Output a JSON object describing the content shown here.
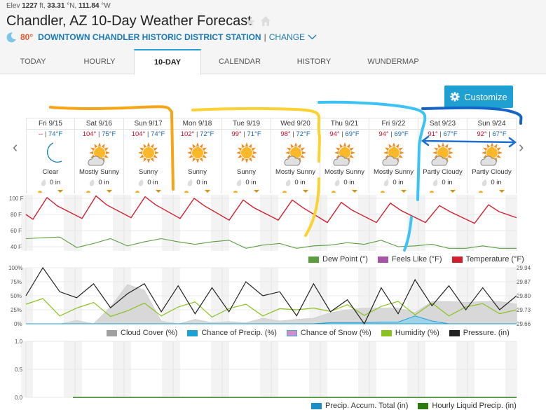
{
  "header": {
    "elevation_label": "Elev",
    "elevation_value": "1227",
    "elevation_unit": "ft,",
    "lat": "33.31",
    "lat_unit": "°N,",
    "lon": "111.84",
    "lon_unit": "°W",
    "title": "Chandler, AZ 10-Day Weather Forecast",
    "current_temp": "80°",
    "station_name": "DOWNTOWN CHANDLER HISTORIC DISTRICT STATION",
    "separator": "|",
    "change_label": "CHANGE"
  },
  "tabs": [
    {
      "label": "TODAY",
      "active": false
    },
    {
      "label": "HOURLY",
      "active": false
    },
    {
      "label": "10-DAY",
      "active": true
    },
    {
      "label": "CALENDAR",
      "active": false
    },
    {
      "label": "HISTORY",
      "active": false
    },
    {
      "label": "WUNDERMAP",
      "active": false
    }
  ],
  "customize_label": "Customize",
  "days": [
    {
      "name": "Fri 9/15",
      "hi": "--",
      "lo": "74°F",
      "icon": "moon-icon",
      "cond": "Clear",
      "precip": "0 in"
    },
    {
      "name": "Sat 9/16",
      "hi": "104°",
      "lo": "75°F",
      "icon": "mostly-sunny-icon",
      "cond": "Mostly Sunny",
      "precip": "0 in"
    },
    {
      "name": "Sun 9/17",
      "hi": "104°",
      "lo": "74°F",
      "icon": "sunny-icon",
      "cond": "Sunny",
      "precip": "0 in"
    },
    {
      "name": "Mon 9/18",
      "hi": "102°",
      "lo": "72°F",
      "icon": "sunny-icon",
      "cond": "Sunny",
      "precip": "0 in"
    },
    {
      "name": "Tue 9/19",
      "hi": "99°",
      "lo": "71°F",
      "icon": "sunny-icon",
      "cond": "Sunny",
      "precip": "0 in"
    },
    {
      "name": "Wed 9/20",
      "hi": "98°",
      "lo": "72°F",
      "icon": "mostly-sunny-icon",
      "cond": "Mostly Sunny",
      "precip": "0 in"
    },
    {
      "name": "Thu 9/21",
      "hi": "94°",
      "lo": "69°F",
      "icon": "mostly-sunny-icon",
      "cond": "Mostly Sunny",
      "precip": "0 in"
    },
    {
      "name": "Fri 9/22",
      "hi": "94°",
      "lo": "69°F",
      "icon": "mostly-sunny-icon",
      "cond": "Mostly Sunny",
      "precip": "0 in"
    },
    {
      "name": "Sat 9/23",
      "hi": "91°",
      "lo": "67°F",
      "icon": "partly-cloudy-icon",
      "cond": "Partly Cloudy",
      "precip": "0 in"
    },
    {
      "name": "Sun 9/24",
      "hi": "92°",
      "lo": "67°F",
      "icon": "partly-cloudy-icon",
      "cond": "Partly Cloudy",
      "precip": "0 in"
    }
  ],
  "colors": {
    "accent": "#1ea0d3",
    "temperature": "#d0202e",
    "dew_point": "#5a9e3e",
    "feels_like": "#a855a8",
    "cloud_cover": "#a0a0a0",
    "precip_chance": "#1ea0d3",
    "snow_chance": "#d08ec8",
    "humidity": "#8cc21e",
    "pressure": "#222222",
    "precip_accum": "#1a8fc4",
    "hourly_precip": "#2a7a10"
  },
  "chart_data": [
    {
      "type": "line",
      "title": "Temperature",
      "x": [
        "Fri 9/15",
        "Sat 9/16",
        "Sun 9/17",
        "Mon 9/18",
        "Tue 9/19",
        "Wed 9/20",
        "Thu 9/21",
        "Fri 9/22",
        "Sat 9/23",
        "Sun 9/24"
      ],
      "yticks": [
        "100 F",
        "80 F",
        "60 F",
        "40 F"
      ],
      "ylim": [
        37,
        102
      ],
      "series": [
        {
          "name": "Temperature (°F)",
          "daily_max": [
            101,
            103,
            102,
            100,
            98,
            98,
            95,
            94,
            91,
            92
          ],
          "daily_min": [
            74,
            75,
            76,
            75,
            73,
            73,
            70,
            70,
            70,
            69
          ],
          "start": 80,
          "end": 76
        },
        {
          "name": "Dew Point (°)",
          "values": [
            50,
            51,
            52,
            39,
            44,
            50,
            41,
            46,
            50,
            46,
            43,
            46,
            48,
            38,
            42,
            44,
            38,
            41,
            42,
            45,
            43,
            48,
            40,
            41,
            43,
            38,
            38,
            41,
            38,
            38
          ]
        },
        {
          "name": "Feels Like (°F)",
          "values": []
        }
      ],
      "legend": [
        "Dew Point (°)",
        "Feels Like (°F)",
        "Temperature (°F)"
      ],
      "legend_position": "bottom-right"
    },
    {
      "type": "line",
      "title": "Cloud / Humidity / Pressure",
      "yticks_left": [
        "100%",
        "75%",
        "50%",
        "25%",
        "0%"
      ],
      "yticks_right": [
        "29.94",
        "29.87",
        "29.80",
        "29.73",
        "29.66"
      ],
      "ylim_left": [
        0,
        100
      ],
      "ylim_right": [
        29.66,
        29.94
      ],
      "series": [
        {
          "name": "Pressure. (in)",
          "values": [
            29.8,
            29.94,
            29.82,
            29.79,
            29.86,
            29.74,
            29.81,
            29.86,
            29.72,
            29.85,
            29.71,
            29.84,
            29.72,
            29.87,
            29.8,
            29.82,
            29.7,
            29.86,
            29.72,
            29.78,
            29.66,
            29.84,
            29.71,
            29.88,
            29.75,
            29.85,
            29.73,
            29.84,
            29.73,
            29.8
          ]
        },
        {
          "name": "Humidity (%)",
          "values": [
            35,
            45,
            14,
            28,
            38,
            13,
            23,
            37,
            14,
            30,
            39,
            12,
            27,
            35,
            14,
            27,
            25,
            28,
            22,
            34,
            15,
            31,
            40,
            16,
            37,
            14,
            30,
            36,
            18,
            25
          ]
        },
        {
          "name": "Cloud Cover (%)",
          "values": [
            0,
            0,
            0,
            6,
            0,
            30,
            70,
            60,
            5,
            0,
            8,
            2,
            4,
            2,
            10,
            5,
            8,
            10,
            20,
            25,
            28,
            28,
            28,
            20,
            40,
            40,
            38,
            40,
            40,
            35
          ]
        },
        {
          "name": "Chance of Precip. (%)",
          "values": [
            0,
            0,
            0,
            0,
            0,
            0,
            0,
            0,
            0,
            0,
            0,
            0,
            0,
            0,
            0,
            0,
            0,
            0,
            2,
            2,
            2,
            3,
            3,
            14,
            5,
            0,
            0,
            0,
            0,
            0
          ]
        },
        {
          "name": "Chance of Snow (%)",
          "values": []
        }
      ],
      "legend": [
        "Cloud Cover (%)",
        "Chance of Precip. (%)",
        "Chance of Snow (%)",
        "Humidity (%)",
        "Pressure. (in)"
      ],
      "legend_position": "bottom"
    },
    {
      "type": "line",
      "title": "Precipitation",
      "yticks": [
        "1.0",
        "0.5",
        "0.0"
      ],
      "ylim": [
        0,
        1
      ],
      "series": [
        {
          "name": "Precip. Accum. Total (in)",
          "values": [
            0,
            0,
            0,
            0,
            0,
            0,
            0,
            0,
            0,
            0
          ]
        },
        {
          "name": "Hourly Liquid Precip. (in)",
          "values": [
            0,
            0,
            0,
            0,
            0,
            0,
            0,
            0,
            0,
            0
          ]
        }
      ],
      "legend": [
        "Precip. Accum. Total (in)",
        "Hourly Liquid Precip. (in)"
      ],
      "legend_position": "bottom-right"
    }
  ]
}
